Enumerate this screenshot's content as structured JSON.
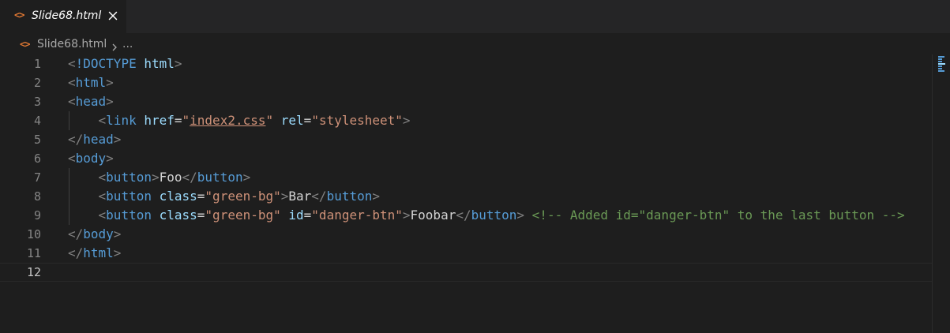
{
  "tab": {
    "icon": "html-file-icon",
    "label": "Slide68.html",
    "close_icon": "close-icon"
  },
  "breadcrumb": {
    "file": "Slide68.html",
    "ellipsis": "..."
  },
  "editor": {
    "current_line": 12,
    "lines": [
      {
        "number": "1",
        "tokens": [
          [
            "punct",
            "<"
          ],
          [
            "doctype",
            "!DOCTYPE"
          ],
          [
            "text",
            " "
          ],
          [
            "attr",
            "html"
          ],
          [
            "punct",
            ">"
          ]
        ]
      },
      {
        "number": "2",
        "tokens": [
          [
            "punct",
            "<"
          ],
          [
            "tag",
            "html"
          ],
          [
            "punct",
            ">"
          ]
        ]
      },
      {
        "number": "3",
        "tokens": [
          [
            "punct",
            "<"
          ],
          [
            "tag",
            "head"
          ],
          [
            "punct",
            ">"
          ]
        ]
      },
      {
        "number": "4",
        "tokens": [
          [
            "text",
            "    "
          ],
          [
            "punct",
            "<"
          ],
          [
            "tag",
            "link"
          ],
          [
            "text",
            " "
          ],
          [
            "attr",
            "href"
          ],
          [
            "text",
            "="
          ],
          [
            "str",
            "\""
          ],
          [
            "link",
            "index2.css"
          ],
          [
            "str",
            "\""
          ],
          [
            "text",
            " "
          ],
          [
            "attr",
            "rel"
          ],
          [
            "text",
            "="
          ],
          [
            "str",
            "\"stylesheet\""
          ],
          [
            "punct",
            ">"
          ]
        ]
      },
      {
        "number": "5",
        "tokens": [
          [
            "punct",
            "</"
          ],
          [
            "tag",
            "head"
          ],
          [
            "punct",
            ">"
          ]
        ]
      },
      {
        "number": "6",
        "tokens": [
          [
            "punct",
            "<"
          ],
          [
            "tag",
            "body"
          ],
          [
            "punct",
            ">"
          ]
        ]
      },
      {
        "number": "7",
        "tokens": [
          [
            "text",
            "    "
          ],
          [
            "punct",
            "<"
          ],
          [
            "tag",
            "button"
          ],
          [
            "punct",
            ">"
          ],
          [
            "text",
            "Foo"
          ],
          [
            "punct",
            "</"
          ],
          [
            "tag",
            "button"
          ],
          [
            "punct",
            ">"
          ]
        ]
      },
      {
        "number": "8",
        "tokens": [
          [
            "text",
            "    "
          ],
          [
            "punct",
            "<"
          ],
          [
            "tag",
            "button"
          ],
          [
            "text",
            " "
          ],
          [
            "attr",
            "class"
          ],
          [
            "text",
            "="
          ],
          [
            "str",
            "\"green-bg\""
          ],
          [
            "punct",
            ">"
          ],
          [
            "text",
            "Bar"
          ],
          [
            "punct",
            "</"
          ],
          [
            "tag",
            "button"
          ],
          [
            "punct",
            ">"
          ]
        ]
      },
      {
        "number": "9",
        "tokens": [
          [
            "text",
            "    "
          ],
          [
            "punct",
            "<"
          ],
          [
            "tag",
            "button"
          ],
          [
            "text",
            " "
          ],
          [
            "attr",
            "class"
          ],
          [
            "text",
            "="
          ],
          [
            "str",
            "\"green-bg\""
          ],
          [
            "text",
            " "
          ],
          [
            "attr",
            "id"
          ],
          [
            "text",
            "="
          ],
          [
            "str",
            "\"danger-btn\""
          ],
          [
            "punct",
            ">"
          ],
          [
            "text",
            "Foobar"
          ],
          [
            "punct",
            "</"
          ],
          [
            "tag",
            "button"
          ],
          [
            "punct",
            ">"
          ],
          [
            "text",
            " "
          ],
          [
            "comment",
            "<!-- Added id=\"danger-btn\" to the last button -->"
          ]
        ]
      },
      {
        "number": "10",
        "tokens": [
          [
            "punct",
            "</"
          ],
          [
            "tag",
            "body"
          ],
          [
            "punct",
            ">"
          ]
        ]
      },
      {
        "number": "11",
        "tokens": [
          [
            "punct",
            "</"
          ],
          [
            "tag",
            "html"
          ],
          [
            "punct",
            ">"
          ]
        ]
      },
      {
        "number": "12",
        "tokens": []
      }
    ]
  },
  "colors": {
    "background": "#1e1e1e",
    "tab_bar": "#252526",
    "file_icon": "#e37933",
    "tag": "#569cd6",
    "attribute": "#9cdcfe",
    "string": "#ce9178",
    "comment": "#6a9955",
    "punctuation": "#808080",
    "line_number": "#858585"
  }
}
